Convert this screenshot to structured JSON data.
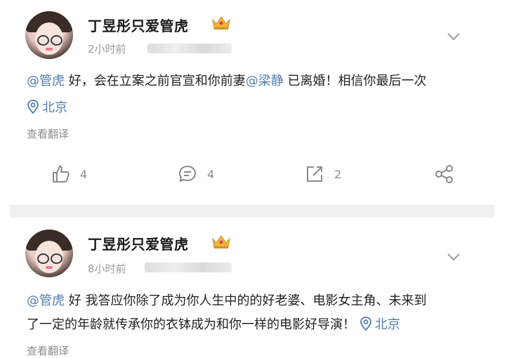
{
  "posts": [
    {
      "author": "丁昱彤只爱管虎",
      "time": "2小时前",
      "mention1": "@管虎",
      "text1": " 好，会在立案之前官宣和你前妻",
      "mention2": "@梁静",
      "text2": " 已离婚！相信你最后一次",
      "location": "北京",
      "translate": "查看翻译",
      "actions": {
        "forward": "4",
        "comment": "4",
        "like": "2"
      }
    },
    {
      "author": "丁昱彤只爱管虎",
      "time": "8小时前",
      "mention1": "@管虎",
      "text1": " 好 我答应你除了成为你人生中的的好老婆、电影女主角、未来到",
      "text2": "了一定的年龄就传承你的衣钵成为和你一样的电影好导演！",
      "location": "北京",
      "translate": "查看翻译"
    }
  ],
  "colors": {
    "link": "#507daf",
    "muted": "#8a8a8a",
    "crown": "#e8a23a"
  },
  "icons": [
    "crown-icon",
    "chevron-down-icon",
    "location-icon",
    "forward-icon",
    "comment-icon",
    "share-icon",
    "like-icon"
  ]
}
